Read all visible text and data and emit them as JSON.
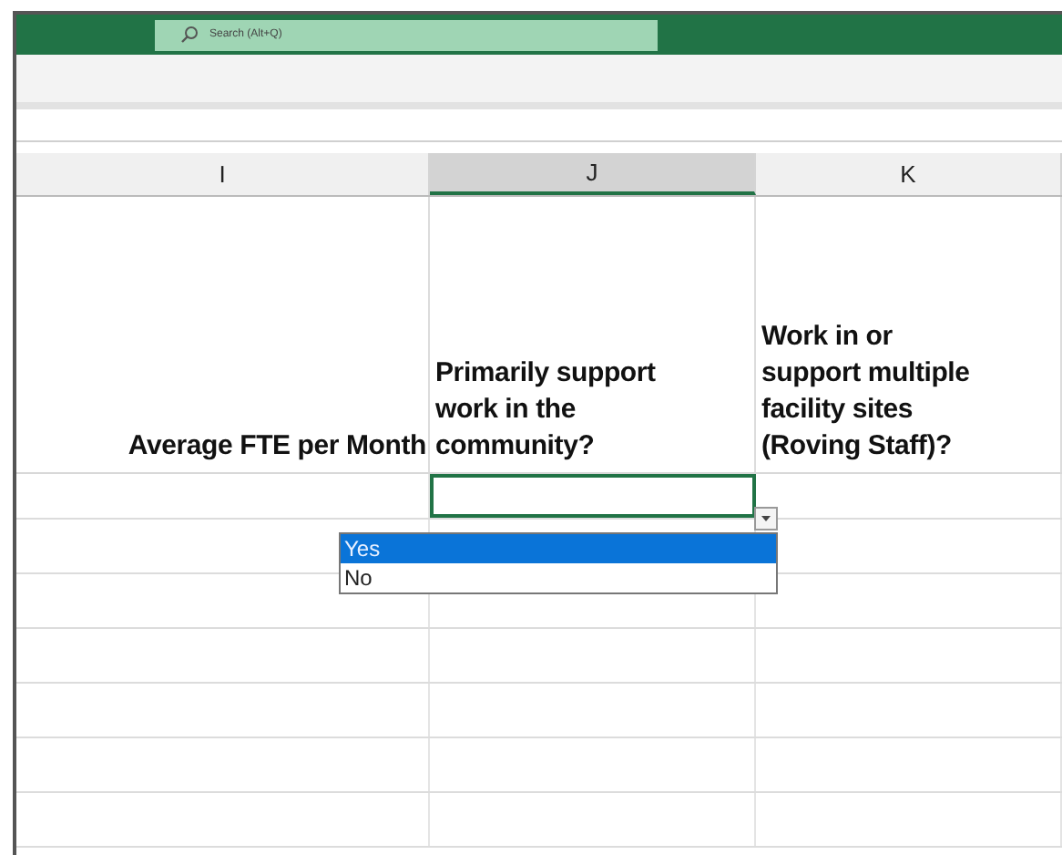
{
  "search": {
    "placeholder": "Search (Alt+Q)"
  },
  "columns": [
    {
      "label": "I",
      "selected": false
    },
    {
      "label": "J",
      "selected": true
    },
    {
      "label": "K",
      "selected": false
    }
  ],
  "header_cells": [
    "Average FTE per Month",
    "Primarily support\nwork in the\ncommunity?",
    "Work in or\nsupport multiple\nfacility sites\n(Roving Staff)?"
  ],
  "dropdown": {
    "options": [
      {
        "label": "Yes",
        "selected": true
      },
      {
        "label": "No",
        "selected": false
      }
    ]
  }
}
